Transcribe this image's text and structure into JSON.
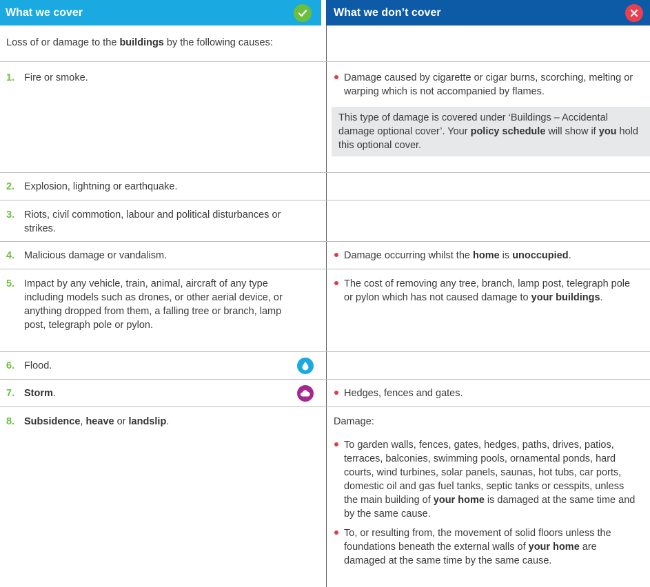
{
  "header": {
    "cover_title": "What we cover",
    "nocover_title": "What we don’t cover",
    "cover_icon": "check-icon",
    "nocover_icon": "cross-icon",
    "colors": {
      "cover": "#1aa9e0",
      "nocover": "#0d5aa7",
      "check": "#6cbf3c",
      "cross": "#e8404f"
    }
  },
  "intro": {
    "prefix": "Loss of or damage to the ",
    "bold": "buildings",
    "suffix": " by the following causes:"
  },
  "rows": [
    {
      "num": "1.",
      "left": "Fire or smoke.",
      "right_bullet": "Damage caused by cigarette or cigar burns, scorching, melting or warping which is not accompanied by flames.",
      "note": {
        "p1": "This type of damage is covered under ‘Buildings – Accidental damage optional cover’. Your ",
        "b1": "policy schedule",
        "p2": " will show if ",
        "b2": "you",
        "p3": " hold this optional cover."
      }
    },
    {
      "num": "2.",
      "left": "Explosion, lightning or earthquake."
    },
    {
      "num": "3.",
      "left": "Riots, civil commotion, labour and political disturbances or strikes."
    },
    {
      "num": "4.",
      "left": "Malicious damage or vandalism.",
      "right": {
        "p1": "Damage occurring whilst the ",
        "b1": "home",
        "p2": " is ",
        "b2": "unoccupied",
        "p3": "."
      }
    },
    {
      "num": "5.",
      "left": "Impact by any vehicle, train, animal, aircraft of any type including models such as drones, or other aerial device, or anything dropped from them, a falling tree or branch, lamp post, telegraph pole or pylon.",
      "right": {
        "p1": "The cost of removing any tree, branch, lamp post, telegraph pole or pylon which has not caused damage to ",
        "b1": "your buildings",
        "p2": "."
      }
    },
    {
      "num": "6.",
      "left": "Flood.",
      "icon": "water-drop-icon"
    },
    {
      "num": "7.",
      "left_bold": "Storm",
      "left_suffix": ".",
      "icon": "cloud-icon",
      "right_bullet": "Hedges, fences and gates."
    },
    {
      "num": "8.",
      "left": {
        "b1": "Subsidence",
        "p1": ", ",
        "b2": "heave",
        "p2": " or ",
        "b3": "landslip",
        "p3": "."
      },
      "right_intro": "Damage:",
      "bullet_a": {
        "p1": "To garden walls, fences, gates, hedges, paths, drives, patios, terraces, balconies, swimming pools, ornamental ponds, hard courts, wind turbines, solar panels, saunas, hot tubs, car ports, domestic oil and gas fuel tanks, septic tanks or cesspits, unless the main building of ",
        "b1": "your home",
        "p2": " is damaged at the same time and by the same cause."
      },
      "bullet_b": {
        "p1": "To, or resulting from, the movement of solid floors unless the foundations beneath the external walls of ",
        "b1": "your home",
        "p2": " are damaged at the same time by the same cause."
      }
    }
  ]
}
